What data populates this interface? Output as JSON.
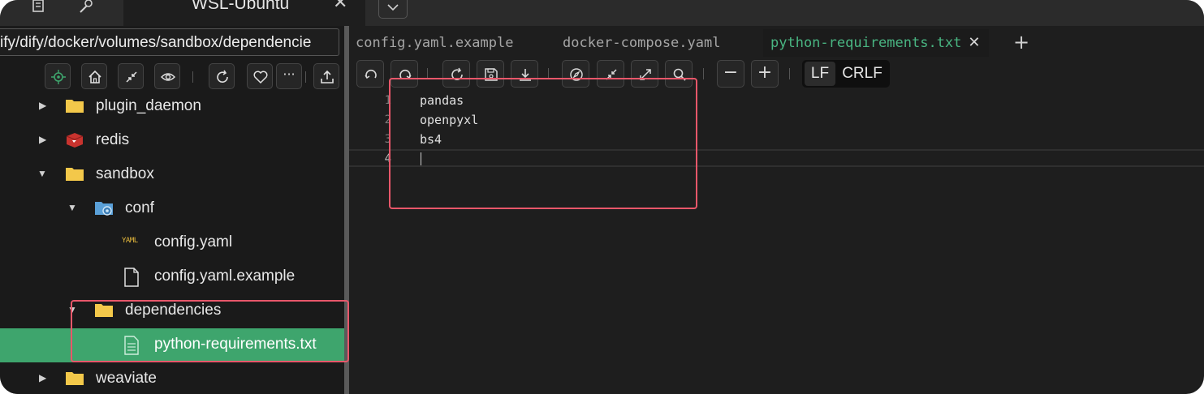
{
  "window": {
    "tab_title": "WSL-Ubuntu",
    "close_glyph": "✕"
  },
  "sidebar": {
    "path_value": "ify/dify/docker/volumes/sandbox/dependencie",
    "toolbar": [
      {
        "icon": "locate-icon"
      },
      {
        "icon": "home-icon"
      },
      {
        "icon": "collapse-icon"
      },
      {
        "icon": "eye-icon"
      },
      {
        "icon": "refresh-icon"
      },
      {
        "icon": "heart-icon"
      },
      {
        "icon": "more-icon",
        "label": "···"
      },
      {
        "icon": "upload-icon"
      }
    ],
    "tree": [
      {
        "label": "plugin_daemon",
        "icon": "folder-icon",
        "expanded": false
      },
      {
        "label": "redis",
        "icon": "redis-icon",
        "expanded": false
      },
      {
        "label": "sandbox",
        "icon": "folder-icon",
        "expanded": true
      },
      {
        "label": "conf",
        "icon": "config-folder-icon",
        "expanded": true
      },
      {
        "label": "config.yaml",
        "icon": "yaml-file-icon",
        "badge": "YAML"
      },
      {
        "label": "config.yaml.example",
        "icon": "file-icon"
      },
      {
        "label": "dependencies",
        "icon": "folder-icon",
        "expanded": true
      },
      {
        "label": "python-requirements.txt",
        "icon": "text-file-icon",
        "selected": true
      },
      {
        "label": "weaviate",
        "icon": "folder-icon",
        "expanded": false
      }
    ]
  },
  "editor": {
    "tabs": [
      {
        "label": "config.yaml.example",
        "active": false
      },
      {
        "label": "docker-compose.yaml",
        "active": false
      },
      {
        "label": "python-requirements.txt",
        "active": true
      }
    ],
    "add_tab_glyph": "+",
    "toolbar": [
      {
        "icon": "undo-icon"
      },
      {
        "icon": "redo-icon"
      },
      {
        "icon": "reload-icon"
      },
      {
        "icon": "save-icon"
      },
      {
        "icon": "download-icon"
      },
      {
        "icon": "compass-icon"
      },
      {
        "icon": "shrink-icon"
      },
      {
        "icon": "expand-icon"
      },
      {
        "icon": "search-icon"
      },
      {
        "icon": "zoom-out-icon",
        "label": "−"
      },
      {
        "icon": "zoom-in-icon",
        "label": "+"
      }
    ],
    "line_endings": {
      "options": [
        "LF",
        "CRLF"
      ],
      "selected": "LF"
    },
    "lines": [
      {
        "num": "1",
        "text": "pandas"
      },
      {
        "num": "2",
        "text": "openpyxl"
      },
      {
        "num": "3",
        "text": "bs4"
      },
      {
        "num": "4",
        "text": ""
      }
    ]
  },
  "colors": {
    "selection": "#3ea56d",
    "active_tab_text": "#49b582",
    "highlight_box": "#e8576a",
    "folder": "#f3c84a"
  }
}
